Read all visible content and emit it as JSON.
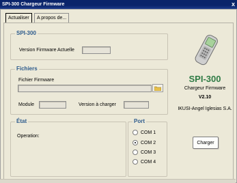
{
  "window": {
    "title": "SPI-300 Chargeur Firmware",
    "close": "x"
  },
  "tabs": [
    {
      "label": "Actualiser"
    },
    {
      "label": "A propos de..."
    }
  ],
  "spi": {
    "title": "SPI-300",
    "firmware_label": "Version Firmware Actuelle",
    "firmware_value": ""
  },
  "fichiers": {
    "title": "Fichiers",
    "firmware_label": "Fichier Firmware",
    "firmware_path": "",
    "module_label": "Module",
    "module_value": "",
    "version_label": "Version à charger",
    "version_value": ""
  },
  "etat": {
    "title": "État",
    "operation_label": "Operation:"
  },
  "port": {
    "title": "Port",
    "options": [
      "COM 1",
      "COM 2",
      "COM 3",
      "COM 4"
    ],
    "selected": "COM 2"
  },
  "brand": {
    "name": "SPI-300",
    "subtitle": "Chargeur Firmware",
    "version": "V2.10",
    "company": "IKUSI-Angel Iglesias S.A."
  },
  "actions": {
    "charger": "Charger"
  },
  "colors": {
    "brand_green": "#2f7b45",
    "group_title": "#2c5a8c",
    "titlebar": "#0a246a",
    "window_bg": "#ece9d8"
  }
}
